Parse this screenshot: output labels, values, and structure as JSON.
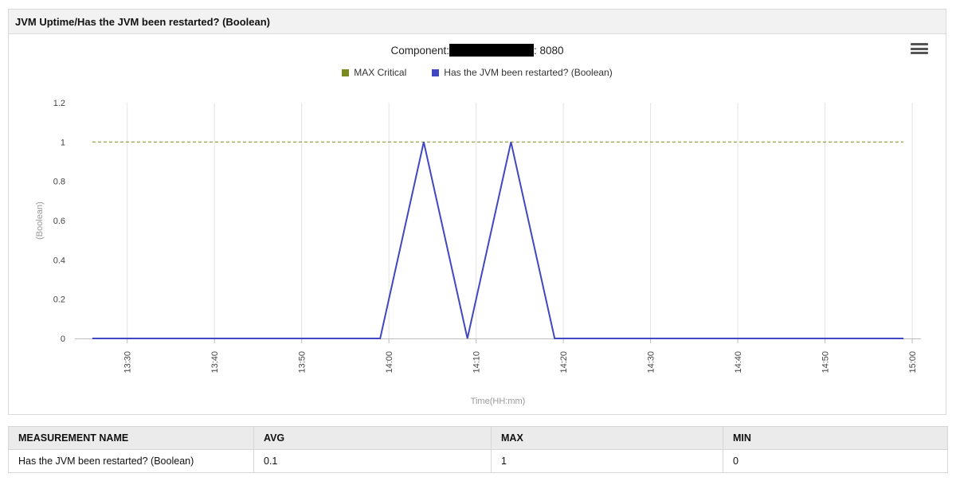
{
  "panel": {
    "title": "JVM Uptime/Has the JVM been restarted? (Boolean)"
  },
  "chart_header": {
    "component_prefix": "Component:",
    "component_suffix": ": 8080"
  },
  "chart_data": {
    "type": "line",
    "title": "",
    "xlabel": "Time(HH:mm)",
    "ylabel": "(Boolean)",
    "ylim": [
      0,
      1.2
    ],
    "yticks": [
      "0",
      "0.2",
      "0.4",
      "0.6",
      "0.8",
      "1",
      "1.2"
    ],
    "xlim": [
      "13:24",
      "15:01"
    ],
    "xticks": [
      "13:30",
      "13:40",
      "13:50",
      "14:00",
      "14:10",
      "14:20",
      "14:30",
      "14:40",
      "14:50",
      "15:00"
    ],
    "grid": true,
    "legend_position": "top",
    "series": [
      {
        "name": "MAX Critical",
        "color": "#7a8a1e",
        "style": "dashed",
        "points": [
          [
            "13:26",
            1
          ],
          [
            "14:59",
            1
          ]
        ]
      },
      {
        "name": "Has the JVM been restarted? (Boolean)",
        "color": "#3f48c0",
        "style": "solid",
        "points": [
          [
            "13:26",
            0
          ],
          [
            "13:59",
            0
          ],
          [
            "14:04",
            1
          ],
          [
            "14:09",
            0
          ],
          [
            "14:14",
            1
          ],
          [
            "14:19",
            0
          ],
          [
            "14:59",
            0
          ]
        ]
      }
    ]
  },
  "stats_table": {
    "headers": [
      "MEASUREMENT NAME",
      "AVG",
      "MAX",
      "MIN"
    ],
    "rows": [
      [
        "Has the JVM been restarted? (Boolean)",
        "0.1",
        "1",
        "0"
      ]
    ]
  }
}
